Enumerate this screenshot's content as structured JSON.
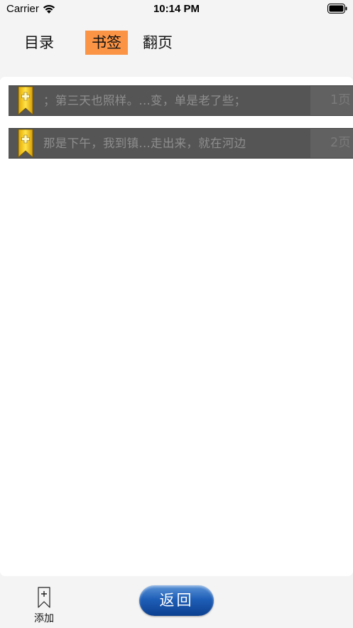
{
  "status_bar": {
    "carrier": "Carrier",
    "time": "10:14 PM"
  },
  "tabs": [
    {
      "label": "目录",
      "selected": false
    },
    {
      "label": "书签",
      "selected": true
    },
    {
      "label": "翻页",
      "selected": false
    }
  ],
  "colors": {
    "tab_selected_bg": "#fb9445",
    "row_bg": "#555555",
    "row_text": "#8e8e8e",
    "back_button": "#1f5fb8"
  },
  "bookmarks": [
    {
      "icon": "bookmark-plus-icon",
      "text": "；第三天也照样。...变，单是老了些；",
      "page": "1页"
    },
    {
      "icon": "bookmark-plus-icon",
      "text": "那是下午，我到镇...走出来，就在河边",
      "page": "2页"
    }
  ],
  "bottom_bar": {
    "add_icon": "bookmark-add-icon",
    "add_label": "添加",
    "back_label": "返回"
  }
}
